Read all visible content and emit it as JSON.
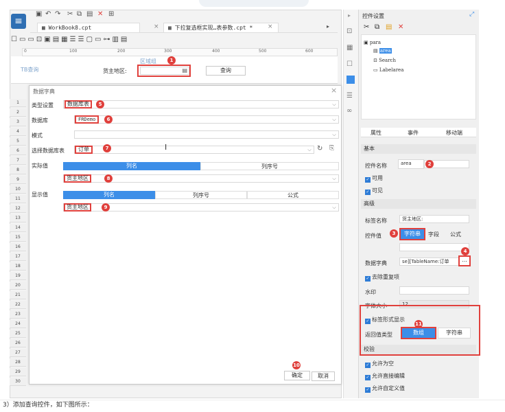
{
  "tabs": {
    "workbook": "WorkBook8.cpt",
    "report": "下拉复选框实现…表参数.cpt *"
  },
  "ruler_ticks": [
    "0",
    "100",
    "200",
    "300",
    "400",
    "500",
    "600"
  ],
  "canvas": {
    "label_left": "TB查询",
    "hint": "区域组",
    "field_label": "货主地区:",
    "query_button": "查询"
  },
  "row_numbers": [
    "1",
    "2",
    "3",
    "4",
    "5",
    "6",
    "7",
    "8",
    "9",
    "10",
    "11",
    "12",
    "13",
    "14",
    "15",
    "16",
    "17",
    "18",
    "19",
    "20",
    "21",
    "22",
    "23",
    "24",
    "25",
    "26",
    "27",
    "28",
    "29",
    "30"
  ],
  "dialog": {
    "title": "数据字典",
    "type_label": "类型设置",
    "type_value": "数据库表",
    "db_label": "数据库",
    "db_value": "FRDemo",
    "schema_label": "模式",
    "table_label": "选择数据库表",
    "table_value": "订单",
    "actual_label": "实际值",
    "actual_cols": [
      "列名",
      "列序号"
    ],
    "actual_value": "货主地区",
    "display_label": "显示值",
    "display_cols": [
      "列名",
      "列序号",
      "公式"
    ],
    "display_value": "货主地区",
    "ok": "确定",
    "cancel": "取消"
  },
  "badges": [
    "1",
    "2",
    "3",
    "4",
    "5",
    "6",
    "7",
    "8",
    "9",
    "10",
    "11"
  ],
  "right_panel": {
    "title": "控件设置",
    "tree": [
      "para",
      "area",
      "Search",
      "Labelarea"
    ],
    "tabs": [
      "属性",
      "事件",
      "移动端"
    ],
    "basic": "基本",
    "name_label": "控件名称",
    "name_value": "area",
    "enabled": "可用",
    "visible": "可见",
    "advanced": "高级",
    "tag_label": "标签名称",
    "tag_value": "货主地区:",
    "value_label": "控件值",
    "value_types": [
      "字符串",
      "字段",
      "公式"
    ],
    "dict_label": "数据字典",
    "dict_value": "se][TableName:订单",
    "dict_btn": "...",
    "dedupe": "去除重复项",
    "watermark_label": "水印",
    "fontsize_label": "字体大小",
    "fontsize_value": "12",
    "tag_display": "标签形式显示",
    "return_type_label": "返回值类型",
    "return_types": [
      "数组",
      "字符串"
    ],
    "validate": "校验",
    "allow_empty": "允许为空",
    "allow_edit": "允许直接编辑",
    "allow_custom": "允许自定义值"
  },
  "caption": "3）添加查询控件，如下图所示："
}
